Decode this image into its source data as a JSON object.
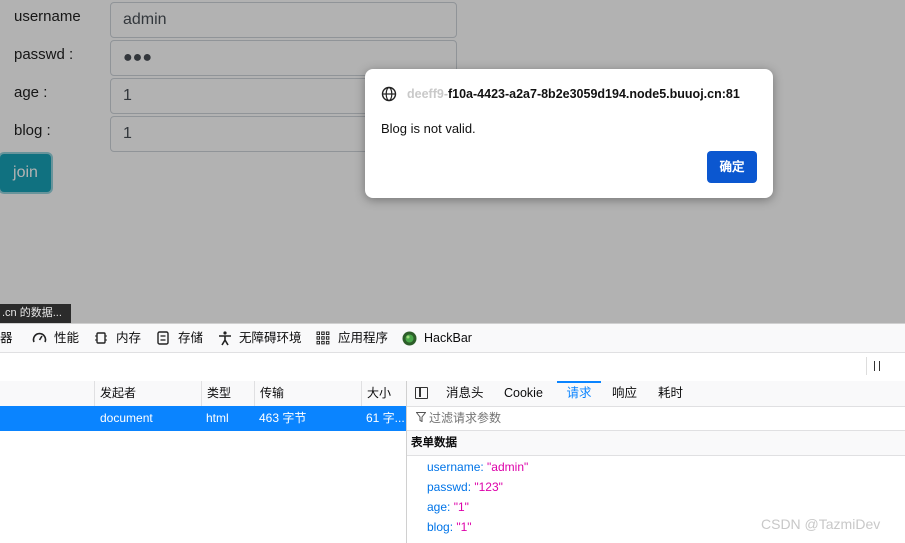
{
  "form": {
    "fields": [
      {
        "label": "username",
        "value": "admin"
      },
      {
        "label": "passwd :",
        "value": "●●●"
      },
      {
        "label": "age :",
        "value": "1"
      },
      {
        "label": "blog :",
        "value": "1"
      }
    ],
    "submit_label": "join"
  },
  "status_tip": ".cn 的数据...",
  "dialog": {
    "origin_faded": "deeff9-",
    "origin": "f10a-4423-a2a7-8b2e3059d194.node5.buuoj.cn:81",
    "message": "Blog is not valid.",
    "ok_label": "确定"
  },
  "devtools": {
    "tabs": [
      {
        "label": "器",
        "icon": "none"
      },
      {
        "label": "性能",
        "icon": "gauge-icon"
      },
      {
        "label": "内存",
        "icon": "chip-icon"
      },
      {
        "label": "存储",
        "icon": "storage-icon"
      },
      {
        "label": "无障碍环境",
        "icon": "accessibility-icon"
      },
      {
        "label": "应用程序",
        "icon": "grid-icon"
      },
      {
        "label": "HackBar",
        "icon": "hackbar-icon"
      }
    ],
    "columns": [
      "发起者",
      "类型",
      "传输",
      "大小"
    ],
    "request": {
      "initiator": "document",
      "type": "html",
      "transferred": "463 字节",
      "size": "61 字..."
    },
    "detail_tabs": [
      "消息头",
      "Cookie",
      "请求",
      "响应",
      "耗时"
    ],
    "active_detail_tab": "请求",
    "filter_placeholder": "过滤请求参数",
    "section_title": "表单数据",
    "params": [
      {
        "key": "username:",
        "value": "\"admin\""
      },
      {
        "key": "passwd:",
        "value": "\"123\""
      },
      {
        "key": "age:",
        "value": "\"1\""
      },
      {
        "key": "blog:",
        "value": "\"1\""
      }
    ]
  },
  "watermark": "CSDN @TazmiDev",
  "colors": {
    "join_button": "#17a2b8",
    "dialog_ok": "#0b57d0",
    "selected_row": "#0a84ff",
    "param_key": "#0074e8",
    "param_value": "#dd00a9"
  }
}
